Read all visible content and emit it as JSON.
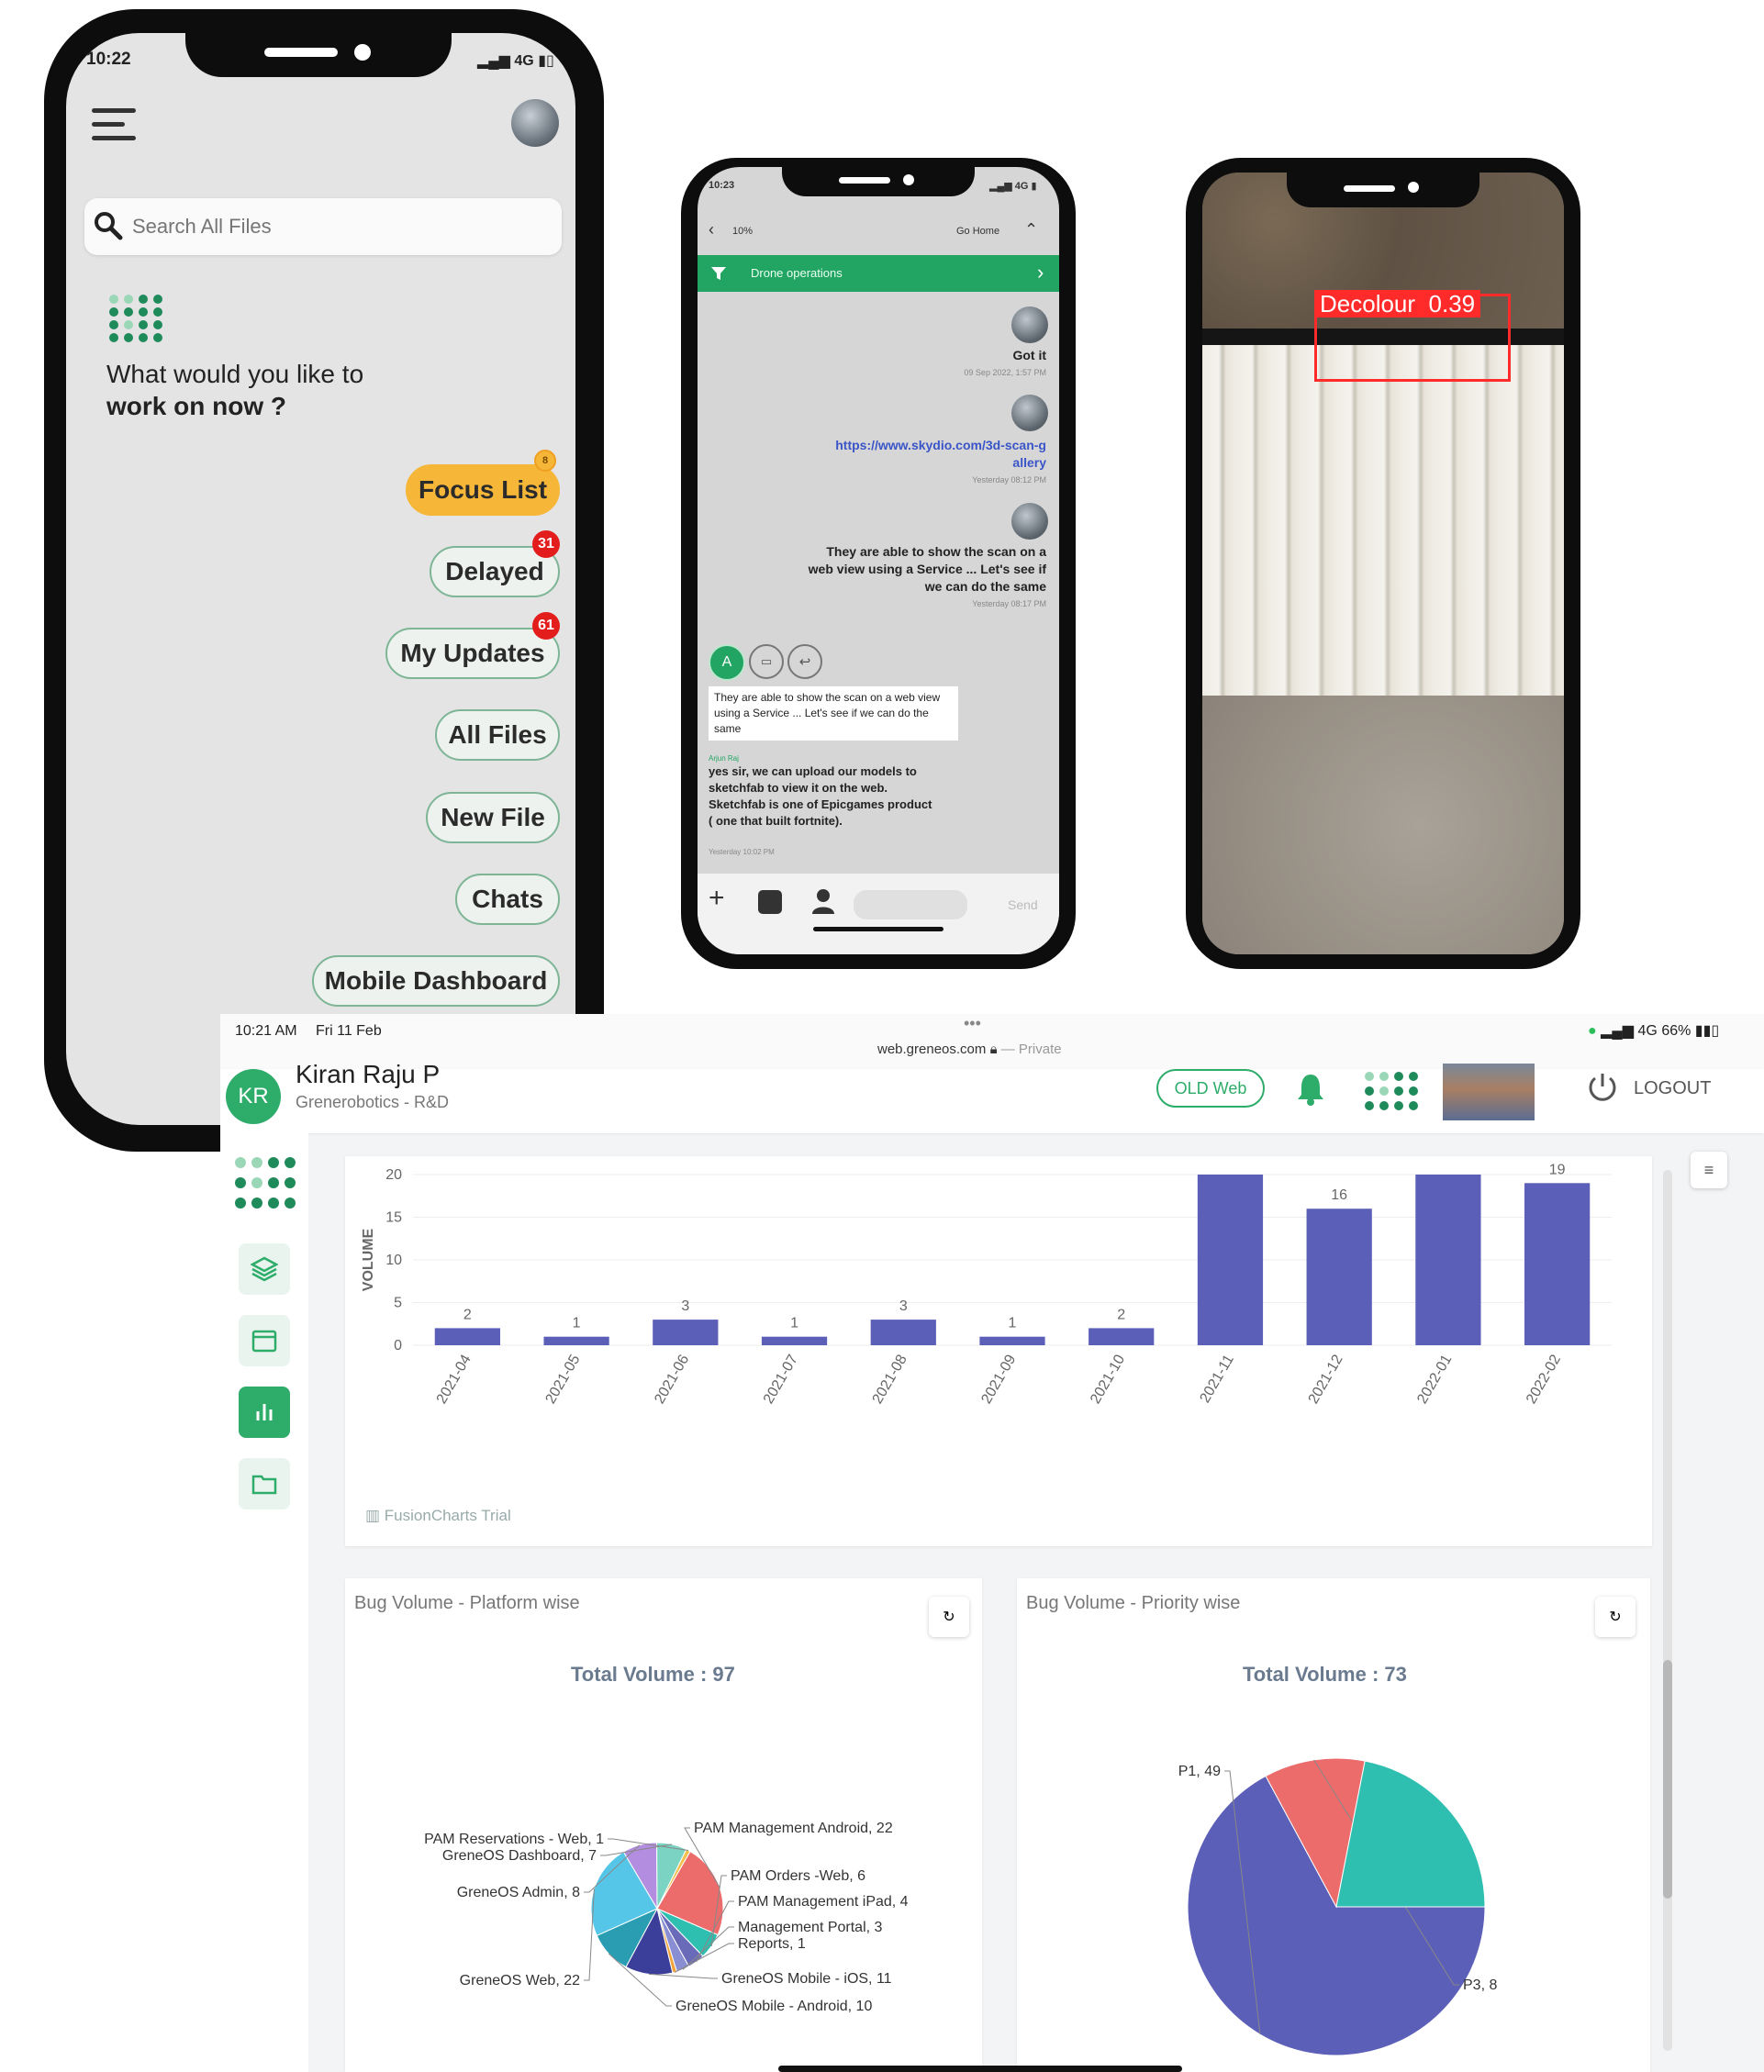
{
  "phone1": {
    "status_time": "10:22",
    "status_network": "4G",
    "search_placeholder": "Search All Files",
    "greeting_line1": "What would you like to",
    "greeting_line2": "work on now ?",
    "buttons": [
      {
        "label": "Focus List",
        "badge": "8"
      },
      {
        "label": "Delayed",
        "badge": "31"
      },
      {
        "label": "My Updates",
        "badge": "61"
      },
      {
        "label": "All Files",
        "badge": ""
      },
      {
        "label": "New File",
        "badge": ""
      },
      {
        "label": "Chats",
        "badge": ""
      },
      {
        "label": "Mobile Dashboard",
        "badge": ""
      }
    ]
  },
  "phone2": {
    "status_time": "10:23",
    "status_network": "4G",
    "back_label": "10%",
    "go_home": "Go Home",
    "channel": "Drone operations",
    "messages": [
      {
        "text": "Got it",
        "time": "09 Sep 2022, 1:57 PM"
      },
      {
        "text": "https://www.skydio.com/3d-scan-gallery",
        "time": "Yesterday 08:12 PM"
      },
      {
        "text": "They are able to show the scan on a web view using a Service ... Let's see if we can do the same",
        "time": "Yesterday 08:17 PM"
      }
    ],
    "avatar_letter": "A",
    "quoted": "They are able to show the scan on a web view using a Service ... Let's see if we can do the same",
    "reply_author": "Arjun Raj",
    "reply": "yes sir, we can upload our models to sketchfab to view it on the web. Sketchfab is one of Epicgames product ( one that built fortnite).",
    "reply_time": "Yesterday 10:02 PM",
    "send": "Send"
  },
  "phone3": {
    "detection_label": "Decolour",
    "detection_score": "0.39"
  },
  "tablet": {
    "status_time": "10:21 AM",
    "status_date": "Fri 11 Feb",
    "url": "web.greneos.com",
    "private": "— Private",
    "battery": "66%",
    "network": "4G",
    "user_initials": "KR",
    "user_name": "Kiran Raju P",
    "user_org": "Grenerobotics - R&D",
    "old_web": "OLD Web",
    "logout": "LOGOUT",
    "watermark": "FusionCharts Trial",
    "platform_title": "Bug Volume - Platform wise",
    "platform_total": "Total Volume : 97",
    "priority_title": "Bug Volume - Priority wise",
    "priority_total": "Total Volume : 73"
  },
  "chart_data": [
    {
      "type": "bar",
      "ylabel": "VOLUME",
      "ylim": [
        0,
        20
      ],
      "yticks": [
        0,
        5,
        10,
        15,
        20
      ],
      "categories": [
        "2021-04",
        "2021-05",
        "2021-06",
        "2021-07",
        "2021-08",
        "2021-09",
        "2021-10",
        "2021-11",
        "2021-12",
        "2022-01",
        "2022-02"
      ],
      "values": [
        2,
        1,
        3,
        1,
        3,
        1,
        2,
        21,
        16,
        21,
        19
      ],
      "data_labels": [
        "2",
        "1",
        "3",
        "1",
        "3",
        "1",
        "2",
        "",
        "16",
        "",
        "19"
      ],
      "color": "#5b5fb8",
      "grid": true
    },
    {
      "type": "pie",
      "title": "Bug Volume - Platform wise",
      "slices": [
        {
          "label": "PAM Management Android, 22",
          "value": 22,
          "color": "#ec6b6b"
        },
        {
          "label": "PAM Orders -Web, 6",
          "value": 6,
          "color": "#2ebfb0"
        },
        {
          "label": "PAM Management iPad, 4",
          "value": 4,
          "color": "#6a6bb8"
        },
        {
          "label": "Management Portal, 3",
          "value": 3,
          "color": "#8a8fd4"
        },
        {
          "label": "Reports, 1",
          "value": 1,
          "color": "#f0a43a"
        },
        {
          "label": "GreneOS Mobile - iOS, 11",
          "value": 11,
          "color": "#3b3f9a"
        },
        {
          "label": "GreneOS Mobile - Android, 10",
          "value": 10,
          "color": "#2a9db2"
        },
        {
          "label": "GreneOS Web, 22",
          "value": 22,
          "color": "#56c6e8"
        },
        {
          "label": "GreneOS Admin, 8",
          "value": 8,
          "color": "#b38ee0"
        },
        {
          "label": "GreneOS Dashboard, 7",
          "value": 7,
          "color": "#7bd3c4"
        },
        {
          "label": "PAM Reservations - Web, 1",
          "value": 1,
          "color": "#f3c04e"
        }
      ]
    },
    {
      "type": "pie",
      "title": "Bug Volume - Priority wise",
      "slices": [
        {
          "label": "P1, 49",
          "value": 49,
          "color": "#5b5fb8"
        },
        {
          "label": "P3, 8",
          "value": 8,
          "color": "#ec6b6b"
        },
        {
          "label": "",
          "value": 16,
          "color": "#2ebfb0"
        }
      ]
    }
  ]
}
